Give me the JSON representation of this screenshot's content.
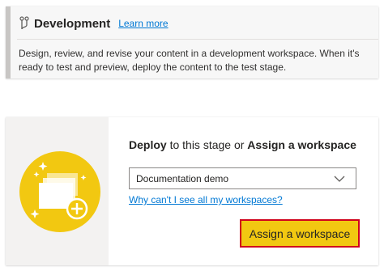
{
  "stage": {
    "icon": "stage-icon",
    "title": "Development",
    "learn_more": "Learn more",
    "description": "Design, review, and revise your content in a development workspace. When it's ready to test and preview, deploy the content to the test stage."
  },
  "assign": {
    "illustration_icon": "workspace-add-illustration",
    "title_part1": "Deploy",
    "title_part2": " to this stage or ",
    "title_part3": "Assign a workspace",
    "workspace_select": {
      "value": "Documentation demo",
      "icon": "chevron-down-icon"
    },
    "help_link": "Why can't I see all my workspaces?",
    "button_label": "Assign a workspace"
  },
  "colors": {
    "accent_bar": "#c8c6c4",
    "link": "#0078d4",
    "button": "#f2c811",
    "highlight_border": "#d0021b"
  }
}
